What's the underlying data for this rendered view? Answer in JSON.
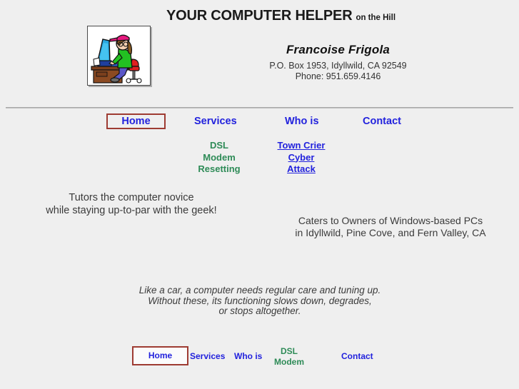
{
  "header": {
    "title_main": "YOUR COMPUTER HELPER",
    "title_sub": "on the Hill",
    "logo_alt": "woman-at-computer-desk-clipart",
    "contact": {
      "name": "Francoise Frigola",
      "address": "P.O. Box 1953, Idyllwild, CA  92549",
      "phone": "Phone: 951.659.4146"
    }
  },
  "main_nav": {
    "home": "Home",
    "services": "Services",
    "who_is": "Who is",
    "contact": "Contact"
  },
  "sublinks": {
    "dsl": {
      "line1": "DSL",
      "line2": "Modem",
      "line3": "Resetting"
    },
    "town_crier": {
      "line1": "Town Crier",
      "line2": "Cyber",
      "line3": "Attack"
    }
  },
  "body": {
    "tutors_line1": "Tutors the computer novice",
    "tutors_line2": "while staying up-to-par with the geek!",
    "caters_line1": "Caters to Owners of Windows-based PCs",
    "caters_line2": "in Idyllwild, Pine Cove, and Fern Valley, CA",
    "tagline_line1": "Like a car, a computer needs regular care and tuning up.",
    "tagline_line2": "Without these, its functioning slows down, degrades,",
    "tagline_line3": "or stops altogether."
  },
  "footer_nav": {
    "home": "Home",
    "services": "Services",
    "who_is": "Who is",
    "dsl_line1": "DSL",
    "dsl_line2": "Modem",
    "contact": "Contact"
  },
  "colors": {
    "page_background": "#efefef",
    "link_blue": "#2222dd",
    "link_green": "#2e8b57",
    "box_border_red": "#9e3b32",
    "text_gray": "#3b3b3b"
  }
}
